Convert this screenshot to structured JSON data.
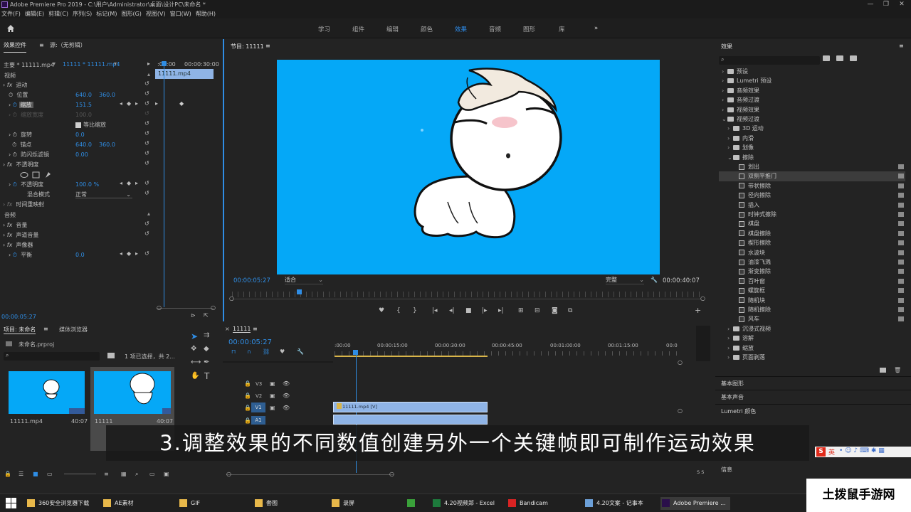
{
  "window": {
    "title": "Adobe Premiere Pro 2019 - C:\\用户\\Administrator\\桌面\\设计PC\\未命名 *",
    "minimize": "—",
    "maximize": "❐",
    "close": "✕"
  },
  "menu": [
    "文件(F)",
    "编辑(E)",
    "剪辑(C)",
    "序列(S)",
    "标记(M)",
    "图形(G)",
    "视图(V)",
    "窗口(W)",
    "帮助(H)"
  ],
  "workspaces": {
    "tabs": [
      "学习",
      "组件",
      "编辑",
      "颜色",
      "效果",
      "音频",
      "图形",
      "库"
    ],
    "active": "效果",
    "more": "»"
  },
  "effect_controls": {
    "tab_active": "效果控件",
    "tab_source": "源:（无剪辑）",
    "master_label": "主要 * 11111.mp4",
    "sequence_label": "11111 * 11111.mp4",
    "time_start": ":00:00",
    "time_end": "00:00:30:00",
    "clip_name": "11111.mp4",
    "video_header": "视频",
    "motion": "运动",
    "position_label": "位置",
    "position_x": "640.0",
    "position_y": "360.0",
    "scale_label": "缩放",
    "scale_value": "151.5",
    "scale_width_label": "缩放宽度",
    "scale_width_value": "100.0",
    "uniform_scale": "等比缩放",
    "rotation_label": "旋转",
    "rotation_value": "0.0",
    "anchor_label": "锚点",
    "anchor_x": "640.0",
    "anchor_y": "360.0",
    "flicker_label": "防闪烁滤镜",
    "flicker_value": "0.00",
    "opacity": "不透明度",
    "opacity_label": "不透明度",
    "opacity_value": "100.0 %",
    "blend_label": "混合模式",
    "blend_value": "正常",
    "time_remap": "时间重映射",
    "audio_header": "音频",
    "volume": "音量",
    "channel_volume": "声道音量",
    "panner": "声像器",
    "balance_label": "平衡",
    "balance_value": "0.0",
    "timecode": "00:00:05:27"
  },
  "program_monitor": {
    "title": "节目: 11111",
    "timecode": "00:00:05:27",
    "fit": "适合",
    "quality": "完整",
    "duration": "00:00:40:07"
  },
  "project": {
    "tab_active": "项目: 未命名",
    "tab_media": "媒体浏览器",
    "file": "未命名.prproj",
    "selection": "1 项已选择，共 2...",
    "items": [
      {
        "name": "11111.mp4",
        "duration": "40:07"
      },
      {
        "name": "11111",
        "duration": "40:07"
      }
    ]
  },
  "timeline": {
    "title": "11111",
    "timecode": "00:00:05:27",
    "ruler": [
      ":00:00",
      "00:00:15:00",
      "00:00:30:00",
      "00:00:45:00",
      "00:01:00:00",
      "00:01:15:00",
      "00:0"
    ],
    "tracks": [
      "V3",
      "V2",
      "V1",
      "A1"
    ],
    "clip": "11111.mp4 [V]",
    "meter": "S S"
  },
  "effects_panel": {
    "title": "效果",
    "tree": [
      {
        "label": "预设",
        "level": 0,
        "type": "folder"
      },
      {
        "label": "Lumetri 预设",
        "level": 0,
        "type": "folder"
      },
      {
        "label": "音频效果",
        "level": 0,
        "type": "folder"
      },
      {
        "label": "音频过渡",
        "level": 0,
        "type": "folder"
      },
      {
        "label": "视频效果",
        "level": 0,
        "type": "folder"
      },
      {
        "label": "视频过渡",
        "level": 0,
        "type": "folder",
        "open": true
      },
      {
        "label": "3D 运动",
        "level": 1,
        "type": "folder"
      },
      {
        "label": "内滑",
        "level": 1,
        "type": "folder"
      },
      {
        "label": "划像",
        "level": 1,
        "type": "folder"
      },
      {
        "label": "擦除",
        "level": 1,
        "type": "folder",
        "open": true
      },
      {
        "label": "划出",
        "level": 2,
        "type": "fx",
        "badge": true
      },
      {
        "label": "双侧平推门",
        "level": 2,
        "type": "fx",
        "badge": true,
        "selected": true
      },
      {
        "label": "带状擦除",
        "level": 2,
        "type": "fx",
        "badge": true
      },
      {
        "label": "径向擦除",
        "level": 2,
        "type": "fx",
        "badge": true
      },
      {
        "label": "插入",
        "level": 2,
        "type": "fx",
        "badge": true
      },
      {
        "label": "时钟式擦除",
        "level": 2,
        "type": "fx",
        "badge": true
      },
      {
        "label": "棋盘",
        "level": 2,
        "type": "fx",
        "badge": true
      },
      {
        "label": "棋盘擦除",
        "level": 2,
        "type": "fx",
        "badge": true
      },
      {
        "label": "楔形擦除",
        "level": 2,
        "type": "fx",
        "badge": true
      },
      {
        "label": "水波块",
        "level": 2,
        "type": "fx",
        "badge": true
      },
      {
        "label": "油漆飞溅",
        "level": 2,
        "type": "fx",
        "badge": true
      },
      {
        "label": "渐变擦除",
        "level": 2,
        "type": "fx",
        "badge": true
      },
      {
        "label": "百叶窗",
        "level": 2,
        "type": "fx",
        "badge": true
      },
      {
        "label": "螺旋框",
        "level": 2,
        "type": "fx",
        "badge": true
      },
      {
        "label": "随机块",
        "level": 2,
        "type": "fx",
        "badge": true
      },
      {
        "label": "随机擦除",
        "level": 2,
        "type": "fx",
        "badge": true
      },
      {
        "label": "风车",
        "level": 2,
        "type": "fx",
        "badge": true
      },
      {
        "label": "沉浸式视频",
        "level": 1,
        "type": "folder"
      },
      {
        "label": "溶解",
        "level": 1,
        "type": "folder"
      },
      {
        "label": "缩放",
        "level": 1,
        "type": "folder"
      },
      {
        "label": "页面剥落",
        "level": 1,
        "type": "folder"
      }
    ],
    "sections": [
      "基本图形",
      "基本声音",
      "Lumetri 颜色"
    ],
    "info": "信息"
  },
  "caption": "3.调整效果的不同数值创建另外一个关键帧即可制作运动效果",
  "ime": "英",
  "taskbar": [
    {
      "label": "360安全浏览器下载",
      "color": "#e8b84a"
    },
    {
      "label": "AE素材",
      "color": "#e8b84a"
    },
    {
      "label": "GIF",
      "color": "#e8b84a"
    },
    {
      "label": "套图",
      "color": "#e8b84a"
    },
    {
      "label": "录屏",
      "color": "#e8b84a"
    },
    {
      "label": "",
      "color": "#3aa13a"
    },
    {
      "label": "4.20视频郑 - Excel",
      "color": "#1d7a3c"
    },
    {
      "label": "Bandicam",
      "color": "#d92323"
    },
    {
      "label": "4.20文案 - 记事本",
      "color": "#6ca0d8"
    },
    {
      "label": "Adobe Premiere ...",
      "color": "#2a0f4a"
    }
  ],
  "watermark": "土拨鼠手游网",
  "colors": {
    "accent": "#2d8ceb",
    "frame_bg": "#05a8f7",
    "clip": "#8fb4e6"
  }
}
